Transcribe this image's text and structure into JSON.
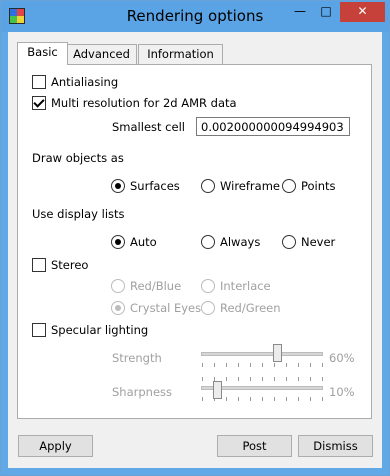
{
  "window": {
    "title": "Rendering options",
    "minimize_label": "—",
    "maximize_label": "□",
    "close_label": "✕"
  },
  "tabs": [
    "Basic",
    "Advanced",
    "Information"
  ],
  "basic": {
    "antialiasing": {
      "label": "Antialiasing",
      "checked": false
    },
    "multires": {
      "label": "Multi resolution for 2d AMR data",
      "checked": true
    },
    "smallest_cell": {
      "label": "Smallest cell",
      "value": "0.002000000094994903"
    },
    "draw_objects": {
      "label": "Draw objects as",
      "options": [
        "Surfaces",
        "Wireframe",
        "Points"
      ],
      "selected": "Surfaces"
    },
    "display_lists": {
      "label": "Use display lists",
      "options": [
        "Auto",
        "Always",
        "Never"
      ],
      "selected": "Auto"
    },
    "stereo": {
      "label": "Stereo",
      "checked": false,
      "options": [
        "Red/Blue",
        "Interlace",
        "Crystal Eyes",
        "Red/Green"
      ],
      "selected": "Crystal Eyes"
    },
    "specular": {
      "label": "Specular lighting",
      "checked": false
    },
    "strength": {
      "label": "Strength",
      "value": 0.6,
      "value_text": "60%"
    },
    "sharpness": {
      "label": "Sharpness",
      "value": 0.1,
      "value_text": "10%"
    }
  },
  "buttons": {
    "apply": "Apply",
    "post": "Post",
    "dismiss": "Dismiss"
  }
}
